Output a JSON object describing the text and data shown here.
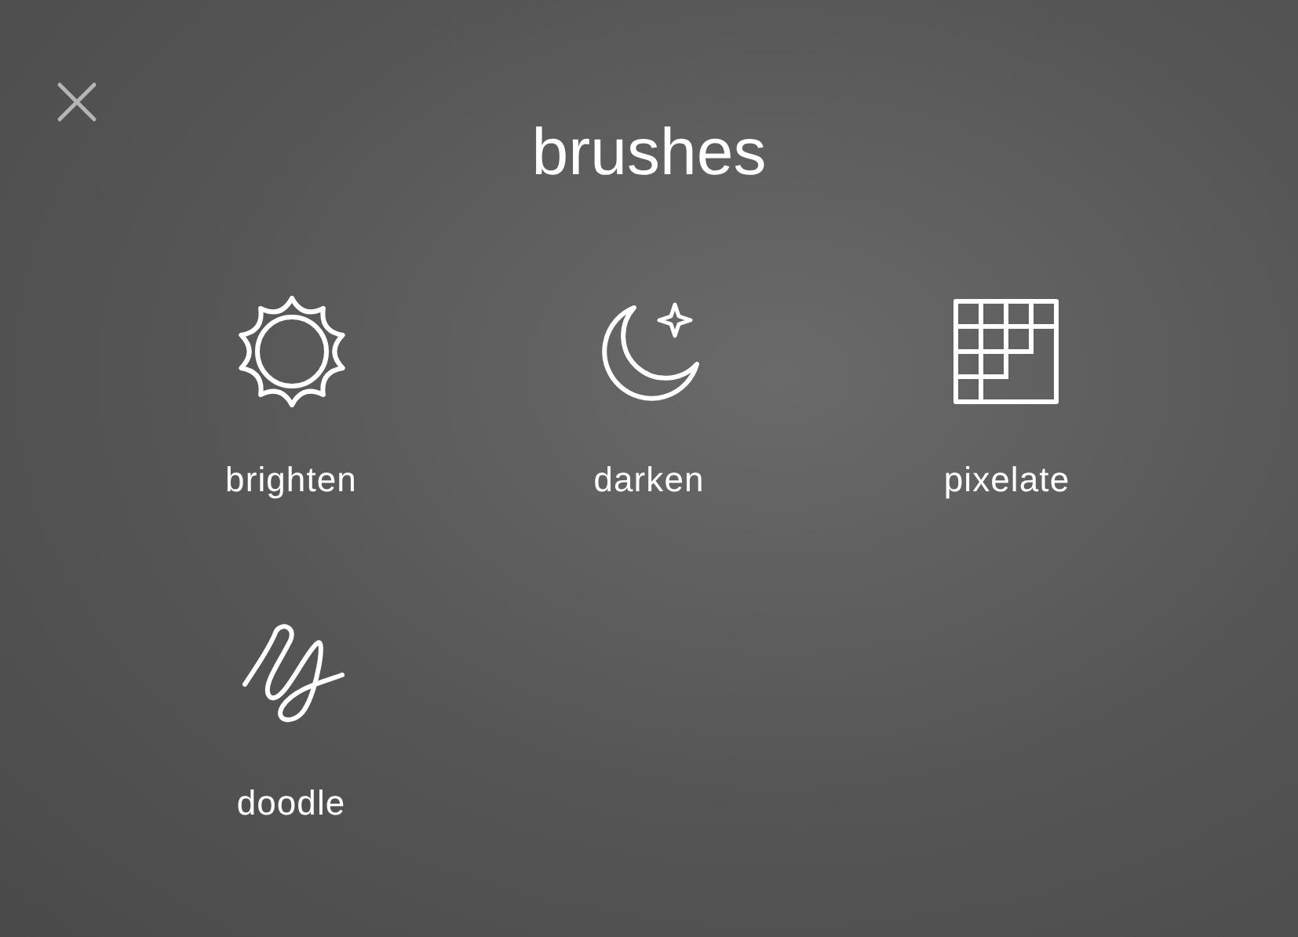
{
  "title": "brushes",
  "brushes": [
    {
      "kind": "brighten",
      "label": "brighten"
    },
    {
      "kind": "darken",
      "label": "darken"
    },
    {
      "kind": "pixelate",
      "label": "pixelate"
    },
    {
      "kind": "doodle",
      "label": "doodle"
    }
  ]
}
